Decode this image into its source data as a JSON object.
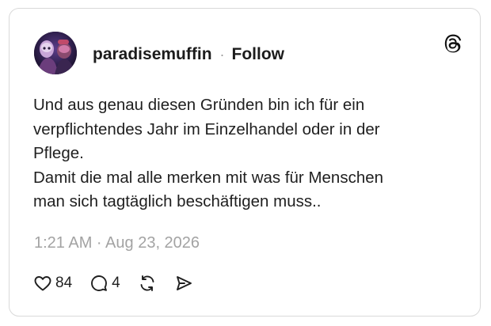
{
  "post": {
    "author": {
      "username": "paradisemuffin",
      "avatar_icon": "profile-photo"
    },
    "separator": "·",
    "follow_label": "Follow",
    "logo_icon": "threads-logo-icon",
    "text_lines": [
      "Und aus genau diesen Gründen bin ich für ein",
      "verpflichtendes Jahr im Einzelhandel oder in der",
      "Pflege.",
      "Damit die mal alle merken mit was für Menschen",
      "man sich tagtäglich beschäftigen muss.."
    ],
    "timestamp": "1:21 AM · Aug 23, 2026",
    "actions": {
      "like": {
        "icon": "heart-icon",
        "count": "84"
      },
      "reply": {
        "icon": "comment-icon",
        "count": "4"
      },
      "repost": {
        "icon": "repost-icon"
      },
      "share": {
        "icon": "send-icon"
      }
    }
  },
  "colors": {
    "text": "#1f1f1f",
    "muted": "#a3a3a3",
    "border": "#d9d9d9"
  }
}
